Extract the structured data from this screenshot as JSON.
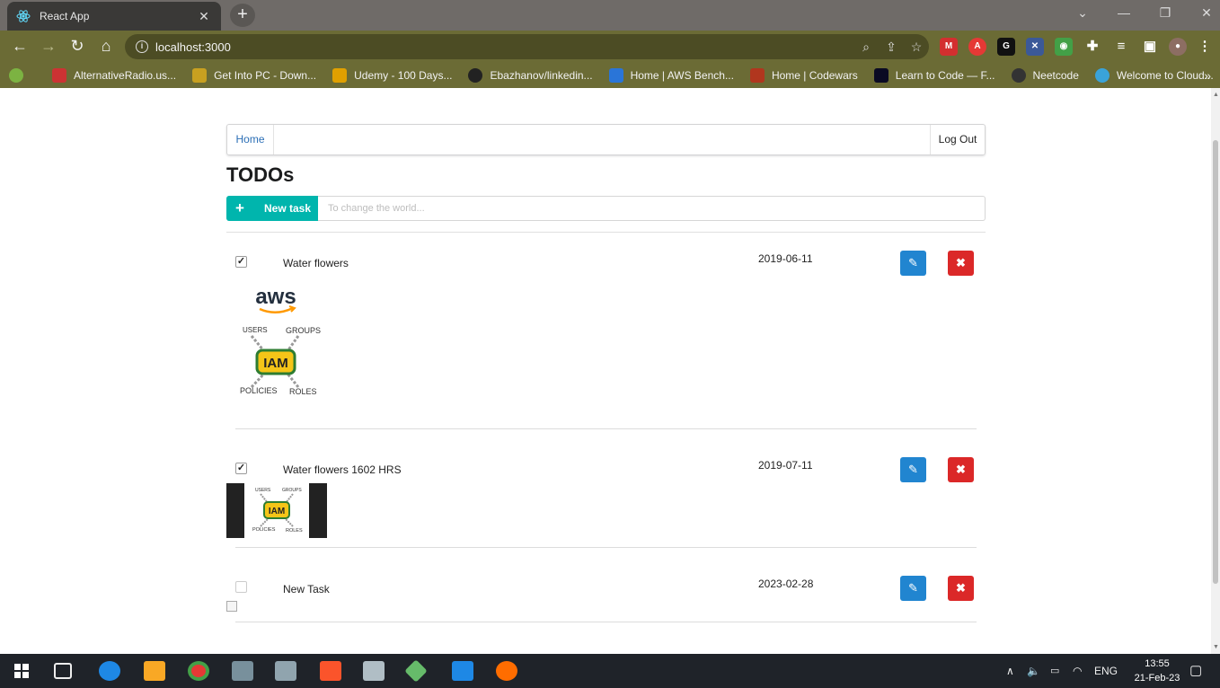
{
  "browser": {
    "tab_title": "React App",
    "tab_close": "✕",
    "new_tab": "+",
    "url": "localhost:3000",
    "window_controls": [
      "⌄",
      "—",
      "❐",
      "✕"
    ],
    "bookmarks": [
      {
        "label": "AlternativeRadio.us...",
        "color": "#cc3333"
      },
      {
        "label": "Get Into PC - Down...",
        "color": "#c8a020"
      },
      {
        "label": "Udemy - 100 Days...",
        "color": "#e0a000"
      },
      {
        "label": "Ebazhanov/linkedin...",
        "color": "#222222"
      },
      {
        "label": "Home | AWS Bench...",
        "color": "#2a75d8"
      },
      {
        "label": "Home | Codewars",
        "color": "#b1361e"
      },
      {
        "label": "Learn to Code — F...",
        "color": "#0a0a23"
      },
      {
        "label": "Neetcode",
        "color": "#333333"
      },
      {
        "label": "Welcome to Cloud...",
        "color": "#3aa3d9"
      }
    ],
    "bookmarks_more": "»"
  },
  "app": {
    "menu": {
      "home": "Home",
      "logout": "Log Out"
    },
    "title": "TODOs",
    "new_task_label": "New task",
    "input_placeholder": "To change the world...",
    "todos": [
      {
        "name": "Water flowers",
        "date": "2019-06-11",
        "done": true,
        "image": "iam-large"
      },
      {
        "name": "Water flowers 1602 HRS",
        "date": "2019-07-11",
        "done": true,
        "image": "iam-small"
      },
      {
        "name": "New Task",
        "date": "2023-02-28",
        "done": false,
        "image": "broken"
      }
    ]
  },
  "iam_image": {
    "brand": "aws",
    "center": "IAM",
    "users": "USERS",
    "groups": "GROUPS",
    "policies": "POLICIES",
    "roles": "ROLES"
  },
  "taskbar": {
    "lang": "ENG",
    "time": "13:55",
    "date": "21-Feb-23"
  }
}
